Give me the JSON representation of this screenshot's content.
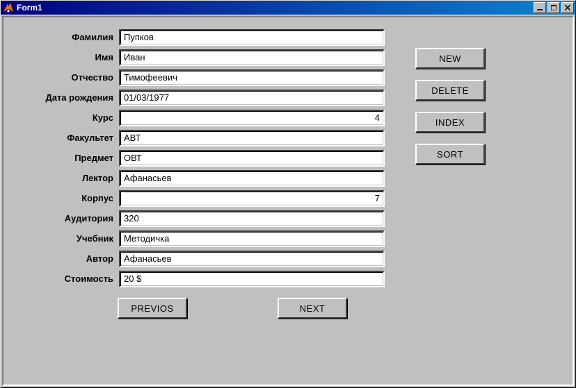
{
  "window": {
    "title": "Form1"
  },
  "labels": {
    "surname": "Фамилия",
    "name": "Имя",
    "patronymic": "Отчество",
    "birthdate": "Дата рождения",
    "course": "Курс",
    "faculty": "Факультет",
    "subject": "Предмет",
    "lecturer": "Лектор",
    "building": "Корпус",
    "room": "Аудитория",
    "textbook": "Учебник",
    "author": "Автор",
    "cost": "Стоимость"
  },
  "values": {
    "surname": "Пупков",
    "name": "Иван",
    "patronymic": "Тимофеевич",
    "birthdate": "01/03/1977",
    "course": "4",
    "faculty": "АВТ",
    "subject": "ОВТ",
    "lecturer": "Афанасьев",
    "building": "7",
    "room": "320",
    "textbook": "Методичка",
    "author": "Афанасьев",
    "cost": "20 $"
  },
  "buttons": {
    "previous": "PREVIOS",
    "next": "NEXT",
    "new": "NEW",
    "delete": "DELETE",
    "index": "INDEX",
    "sort": "SORT"
  },
  "window_controls": {
    "minimize": "_",
    "maximize": "◻",
    "close": "✕"
  }
}
